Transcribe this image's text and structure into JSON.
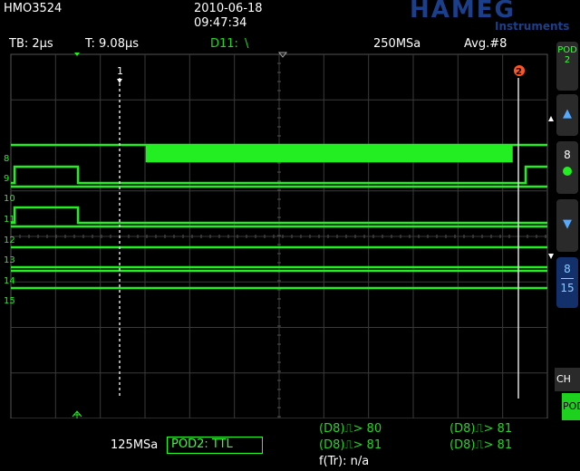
{
  "header": {
    "model": "HMO3524",
    "date": "2010-06-18",
    "time": "09:47:34",
    "brand": "HAMEG",
    "brand_sub": "Instruments"
  },
  "infobar": {
    "timebase": "TB: 2µs",
    "trigger_time": "T: 9.08µs",
    "trigger_source": "D11:",
    "trigger_edge": "\\",
    "sample_rate": "250MSa",
    "acquire_mode": "Avg.#8"
  },
  "markers": {
    "cursor1": "1",
    "cursor2": "2"
  },
  "channels": [
    "8",
    "9",
    "10",
    "11",
    "12",
    "13",
    "14",
    "15"
  ],
  "right_panel": {
    "pod_label": "POD2",
    "up_arrow": "▲",
    "channel_num": "8",
    "down_arrow": "▼",
    "range_top": "8",
    "range_bottom": "15",
    "ch_tab": "CH",
    "pod_tab": "POD"
  },
  "bottom": {
    "sample_rate": "125MSa",
    "pod_box": "POD2: TTL",
    "meas1": "(D8)⎍> 80",
    "meas2": "(D8)⎍> 81",
    "meas3": "(D8)⎍> 81",
    "meas4": "(D8)⎍> 81",
    "freq": "f(Tr): n/a"
  },
  "colors": {
    "trace": "#22ee22",
    "grid": "#3a3a3a",
    "brand": "#1c3f8c",
    "cursor2": "#ff5522"
  }
}
